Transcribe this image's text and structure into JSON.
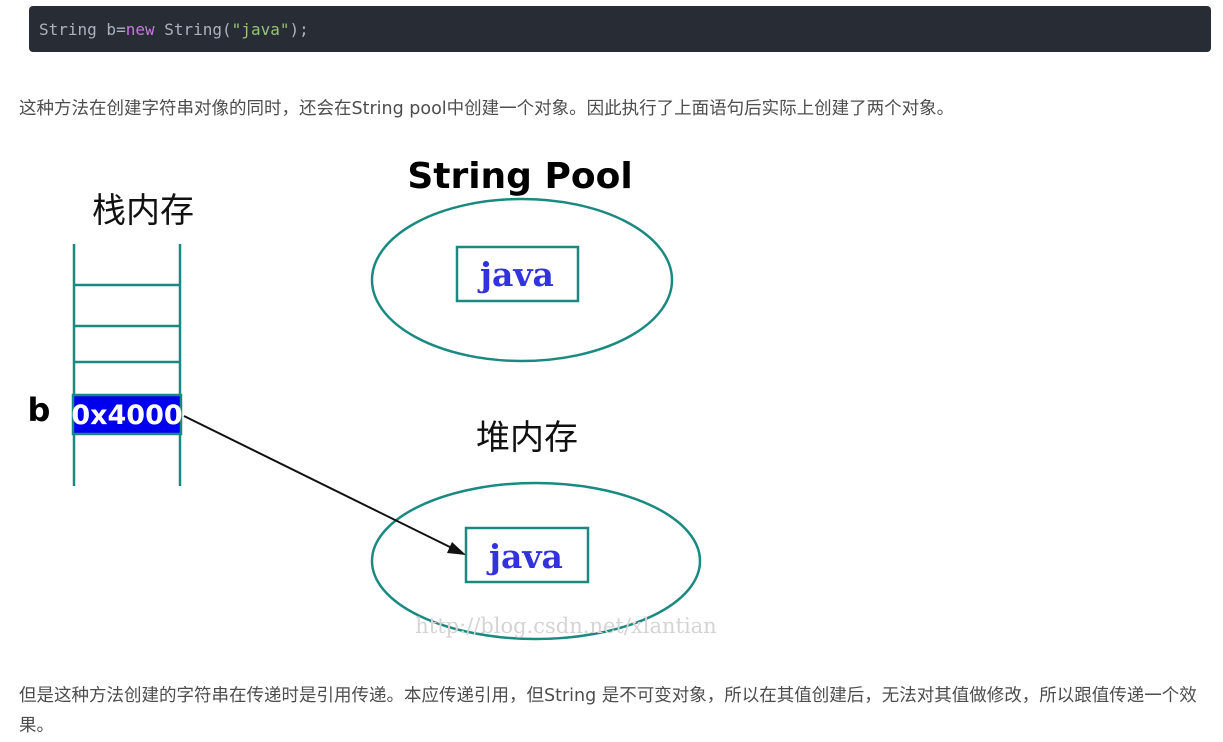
{
  "code": {
    "t1": "String b=",
    "kw": "new",
    "t2": " String(",
    "str": "\"java\"",
    "t3": ");"
  },
  "paragraph1": "这种方法在创建字符串对像的同时，还会在String pool中创建一个对象。因此执行了上面语句后实际上创建了两个对象。",
  "diagram": {
    "stack_title": "栈内存",
    "variable": "b",
    "address": "0x4000",
    "pool_title": "String Pool",
    "pool_value": "java",
    "heap_title": "堆内存",
    "heap_value": "java",
    "watermark": "http://blog.csdn.net/xlantian",
    "colors": {
      "teal": "#1a8a80",
      "address_bg": "#0000ee",
      "value_text": "#3333dd"
    }
  },
  "paragraph2": "但是这种方法创建的字符串在传递时是引用传递。本应传递引用，但String 是不可变对象，所以在其值创建后，无法对其值做修改，所以跟值传递一个效果。"
}
